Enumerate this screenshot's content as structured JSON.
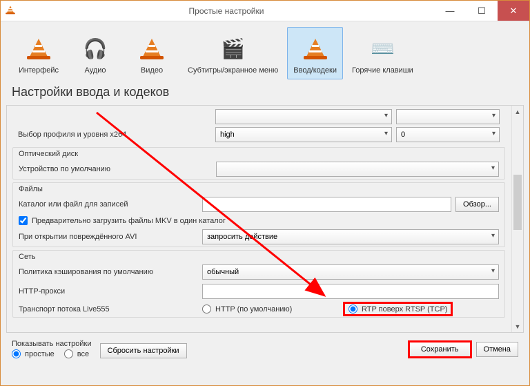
{
  "window": {
    "title": "Простые настройки"
  },
  "categories": {
    "interface": "Интерфейс",
    "audio": "Аудио",
    "video": "Видео",
    "subtitles": "Субтитры/экранное меню",
    "input_codecs": "Ввод/кодеки",
    "hotkeys": "Горячие клавиши"
  },
  "page": {
    "title": "Настройки ввода и кодеков"
  },
  "x264": {
    "label": "Выбор профиля и уровня x264",
    "profile_value": "high",
    "level_value": "0"
  },
  "optical": {
    "group_title": "Оптический диск",
    "device_label": "Устройство по умолчанию",
    "device_value": ""
  },
  "files": {
    "group_title": "Файлы",
    "record_label": "Каталог или файл для записей",
    "record_value": "",
    "browse": "Обзор...",
    "preload_mkv": "Предварительно загрузить файлы MKV в один каталог",
    "damaged_avi_label": "При открытии повреждённого AVI",
    "damaged_avi_value": "запросить действие"
  },
  "network": {
    "group_title": "Сеть",
    "caching_label": "Политика кэширования по умолчанию",
    "caching_value": "обычный",
    "http_proxy_label": "HTTP-прокси",
    "http_proxy_value": "",
    "live555_label": "Транспорт потока Live555",
    "http_option": "HTTP (по умолчанию)",
    "rtp_option": "RTP поверх RTSP (TCP)"
  },
  "footer": {
    "show_label": "Показывать настройки",
    "simple": "простые",
    "all": "все",
    "reset": "Сбросить настройки",
    "save": "Сохранить",
    "cancel": "Отмена"
  }
}
